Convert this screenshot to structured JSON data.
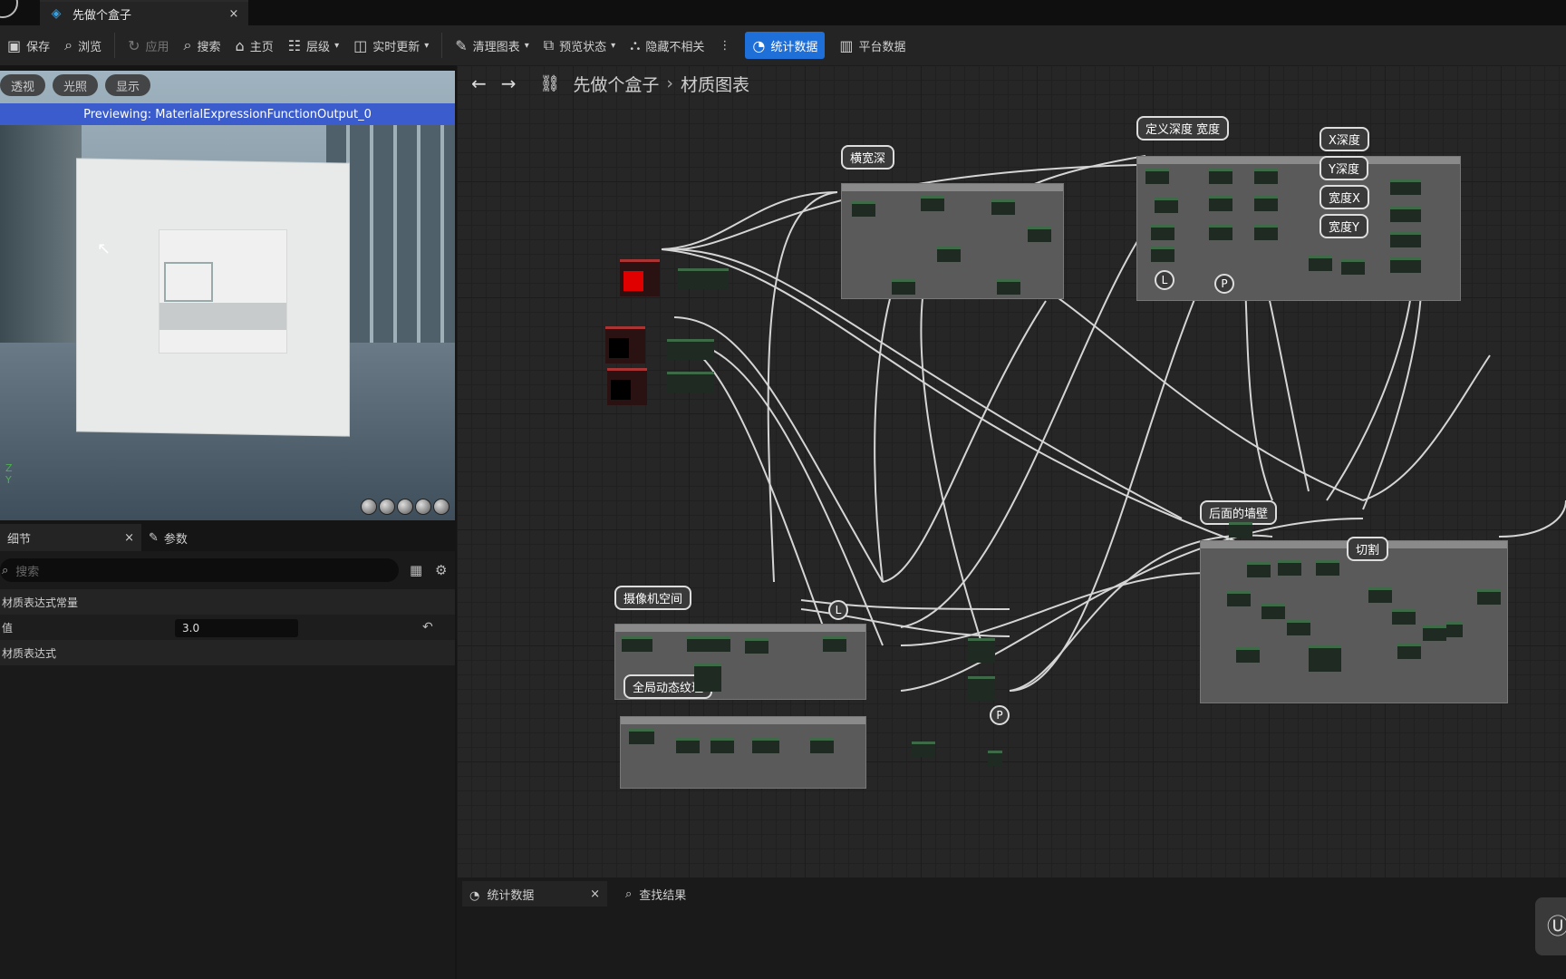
{
  "app": {
    "tab_title": "先做个盒子",
    "tab_close": "×"
  },
  "toolbar": [
    {
      "id": "save",
      "label": "保存",
      "icon": "save-icon"
    },
    {
      "id": "browse",
      "label": "浏览",
      "icon": "browse-icon"
    },
    {
      "id": "apply",
      "label": "应用",
      "icon": "apply-icon",
      "disabled": true
    },
    {
      "id": "search",
      "label": "搜索",
      "icon": "search-icon"
    },
    {
      "id": "home",
      "label": "主页",
      "icon": "home-icon"
    },
    {
      "id": "hierarchy",
      "label": "层级",
      "icon": "hierarchy-icon",
      "dropdown": true
    },
    {
      "id": "live_update",
      "label": "实时更新",
      "icon": "live-update-icon",
      "dropdown": true
    },
    {
      "id": "clean_graph",
      "label": "清理图表",
      "icon": "brush-icon",
      "dropdown": true
    },
    {
      "id": "preview_state",
      "label": "预览状态",
      "icon": "preview-state-icon",
      "dropdown": true
    },
    {
      "id": "hide_unrelated",
      "label": "隐藏不相关",
      "icon": "hide-unrelated-icon"
    },
    {
      "id": "stats",
      "label": "统计数据",
      "icon": "stats-icon",
      "active": true
    },
    {
      "id": "platform_stats",
      "label": "平台数据",
      "icon": "platform-stats-icon"
    }
  ],
  "viewport": {
    "buttons": [
      "透视",
      "光照",
      "显示"
    ],
    "preview_text": "Previewing: MaterialExpressionFunctionOutput_0",
    "axes": {
      "z": "Z",
      "y": "Y"
    }
  },
  "details": {
    "tab_details": "细节",
    "tab_close": "×",
    "tab_params": "参数",
    "search_placeholder": "搜索",
    "section_constant": "材质表达式常量",
    "value_label": "值",
    "value": "3.0",
    "section_expression": "材质表达式"
  },
  "graph": {
    "breadcrumb": [
      "先做个盒子",
      "材质图表"
    ],
    "comments": [
      "横宽深",
      "定义深度 宽度",
      "后面的墙壁",
      "摄像机空间",
      "全局动态纹理"
    ],
    "labels": [
      "X深度",
      "Y深度",
      "宽度X",
      "宽度Y",
      "切割"
    ],
    "pins": [
      "L",
      "P",
      "L",
      "P"
    ]
  },
  "bottom": {
    "tab_stats": "统计数据",
    "tab_close": "×",
    "tab_find": "查找结果"
  },
  "colors": {
    "accent": "#1f6fd8",
    "graph_bg": "#262626",
    "node_header": "#3f6a48",
    "red_node": "#e00000"
  }
}
